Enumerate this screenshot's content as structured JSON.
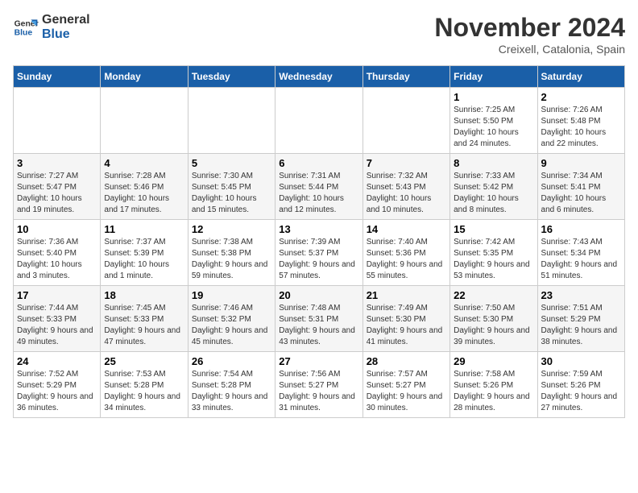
{
  "logo": {
    "line1": "General",
    "line2": "Blue"
  },
  "title": "November 2024",
  "location": "Creixell, Catalonia, Spain",
  "weekdays": [
    "Sunday",
    "Monday",
    "Tuesday",
    "Wednesday",
    "Thursday",
    "Friday",
    "Saturday"
  ],
  "weeks": [
    [
      {
        "day": "",
        "info": ""
      },
      {
        "day": "",
        "info": ""
      },
      {
        "day": "",
        "info": ""
      },
      {
        "day": "",
        "info": ""
      },
      {
        "day": "",
        "info": ""
      },
      {
        "day": "1",
        "info": "Sunrise: 7:25 AM\nSunset: 5:50 PM\nDaylight: 10 hours and 24 minutes."
      },
      {
        "day": "2",
        "info": "Sunrise: 7:26 AM\nSunset: 5:48 PM\nDaylight: 10 hours and 22 minutes."
      }
    ],
    [
      {
        "day": "3",
        "info": "Sunrise: 7:27 AM\nSunset: 5:47 PM\nDaylight: 10 hours and 19 minutes."
      },
      {
        "day": "4",
        "info": "Sunrise: 7:28 AM\nSunset: 5:46 PM\nDaylight: 10 hours and 17 minutes."
      },
      {
        "day": "5",
        "info": "Sunrise: 7:30 AM\nSunset: 5:45 PM\nDaylight: 10 hours and 15 minutes."
      },
      {
        "day": "6",
        "info": "Sunrise: 7:31 AM\nSunset: 5:44 PM\nDaylight: 10 hours and 12 minutes."
      },
      {
        "day": "7",
        "info": "Sunrise: 7:32 AM\nSunset: 5:43 PM\nDaylight: 10 hours and 10 minutes."
      },
      {
        "day": "8",
        "info": "Sunrise: 7:33 AM\nSunset: 5:42 PM\nDaylight: 10 hours and 8 minutes."
      },
      {
        "day": "9",
        "info": "Sunrise: 7:34 AM\nSunset: 5:41 PM\nDaylight: 10 hours and 6 minutes."
      }
    ],
    [
      {
        "day": "10",
        "info": "Sunrise: 7:36 AM\nSunset: 5:40 PM\nDaylight: 10 hours and 3 minutes."
      },
      {
        "day": "11",
        "info": "Sunrise: 7:37 AM\nSunset: 5:39 PM\nDaylight: 10 hours and 1 minute."
      },
      {
        "day": "12",
        "info": "Sunrise: 7:38 AM\nSunset: 5:38 PM\nDaylight: 9 hours and 59 minutes."
      },
      {
        "day": "13",
        "info": "Sunrise: 7:39 AM\nSunset: 5:37 PM\nDaylight: 9 hours and 57 minutes."
      },
      {
        "day": "14",
        "info": "Sunrise: 7:40 AM\nSunset: 5:36 PM\nDaylight: 9 hours and 55 minutes."
      },
      {
        "day": "15",
        "info": "Sunrise: 7:42 AM\nSunset: 5:35 PM\nDaylight: 9 hours and 53 minutes."
      },
      {
        "day": "16",
        "info": "Sunrise: 7:43 AM\nSunset: 5:34 PM\nDaylight: 9 hours and 51 minutes."
      }
    ],
    [
      {
        "day": "17",
        "info": "Sunrise: 7:44 AM\nSunset: 5:33 PM\nDaylight: 9 hours and 49 minutes."
      },
      {
        "day": "18",
        "info": "Sunrise: 7:45 AM\nSunset: 5:33 PM\nDaylight: 9 hours and 47 minutes."
      },
      {
        "day": "19",
        "info": "Sunrise: 7:46 AM\nSunset: 5:32 PM\nDaylight: 9 hours and 45 minutes."
      },
      {
        "day": "20",
        "info": "Sunrise: 7:48 AM\nSunset: 5:31 PM\nDaylight: 9 hours and 43 minutes."
      },
      {
        "day": "21",
        "info": "Sunrise: 7:49 AM\nSunset: 5:30 PM\nDaylight: 9 hours and 41 minutes."
      },
      {
        "day": "22",
        "info": "Sunrise: 7:50 AM\nSunset: 5:30 PM\nDaylight: 9 hours and 39 minutes."
      },
      {
        "day": "23",
        "info": "Sunrise: 7:51 AM\nSunset: 5:29 PM\nDaylight: 9 hours and 38 minutes."
      }
    ],
    [
      {
        "day": "24",
        "info": "Sunrise: 7:52 AM\nSunset: 5:29 PM\nDaylight: 9 hours and 36 minutes."
      },
      {
        "day": "25",
        "info": "Sunrise: 7:53 AM\nSunset: 5:28 PM\nDaylight: 9 hours and 34 minutes."
      },
      {
        "day": "26",
        "info": "Sunrise: 7:54 AM\nSunset: 5:28 PM\nDaylight: 9 hours and 33 minutes."
      },
      {
        "day": "27",
        "info": "Sunrise: 7:56 AM\nSunset: 5:27 PM\nDaylight: 9 hours and 31 minutes."
      },
      {
        "day": "28",
        "info": "Sunrise: 7:57 AM\nSunset: 5:27 PM\nDaylight: 9 hours and 30 minutes."
      },
      {
        "day": "29",
        "info": "Sunrise: 7:58 AM\nSunset: 5:26 PM\nDaylight: 9 hours and 28 minutes."
      },
      {
        "day": "30",
        "info": "Sunrise: 7:59 AM\nSunset: 5:26 PM\nDaylight: 9 hours and 27 minutes."
      }
    ]
  ]
}
